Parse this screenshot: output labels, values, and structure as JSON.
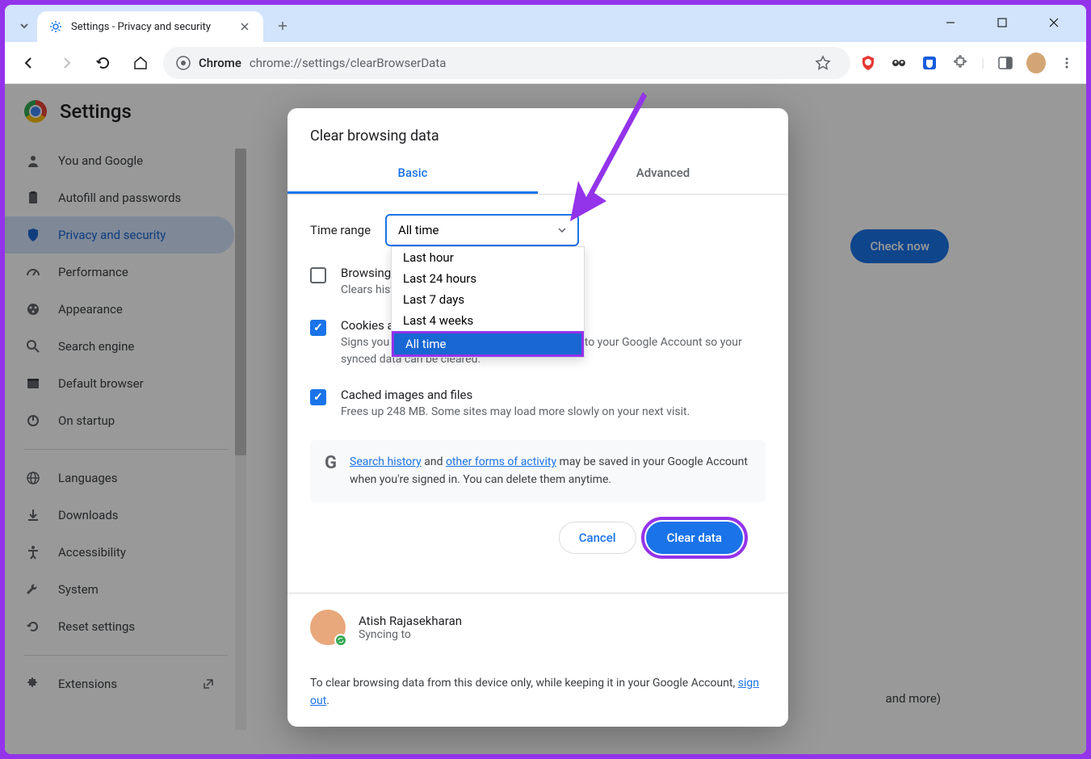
{
  "window": {
    "tab_title": "Settings - Privacy and security",
    "omnibox_label": "Chrome",
    "url": "chrome://settings/clearBrowserData"
  },
  "settings": {
    "title": "Settings",
    "nav": [
      {
        "label": "You and Google",
        "icon": "person"
      },
      {
        "label": "Autofill and passwords",
        "icon": "clipboard"
      },
      {
        "label": "Privacy and security",
        "icon": "shield"
      },
      {
        "label": "Performance",
        "icon": "speedometer"
      },
      {
        "label": "Appearance",
        "icon": "palette"
      },
      {
        "label": "Search engine",
        "icon": "search"
      },
      {
        "label": "Default browser",
        "icon": "browser"
      },
      {
        "label": "On startup",
        "icon": "power"
      }
    ],
    "nav2": [
      {
        "label": "Languages",
        "icon": "globe"
      },
      {
        "label": "Downloads",
        "icon": "download"
      },
      {
        "label": "Accessibility",
        "icon": "accessibility"
      },
      {
        "label": "System",
        "icon": "wrench"
      },
      {
        "label": "Reset settings",
        "icon": "reset"
      }
    ],
    "nav3": [
      {
        "label": "Extensions",
        "icon": "puzzle"
      }
    ],
    "check_now": "Check now",
    "bg_text": "and more)"
  },
  "dialog": {
    "title": "Clear browsing data",
    "tabs": {
      "basic": "Basic",
      "advanced": "Advanced"
    },
    "time_range_label": "Time range",
    "time_range_value": "All time",
    "time_range_options": [
      "Last hour",
      "Last 24 hours",
      "Last 7 days",
      "Last 4 weeks",
      "All time"
    ],
    "items": [
      {
        "checked": false,
        "title": "Browsing history",
        "desc": "Clears history"
      },
      {
        "checked": true,
        "title": "Cookies and other site data",
        "desc": "Signs you out of most sites. You'll stay signed in to your Google Account so your synced data can be cleared."
      },
      {
        "checked": true,
        "title": "Cached images and files",
        "desc": "Frees up 248 MB. Some sites may load more slowly on your next visit."
      }
    ],
    "info": {
      "link1": "Search history",
      "mid": " and ",
      "link2": "other forms of activity",
      "rest": " may be saved in your Google Account when you're signed in. You can delete them anytime."
    },
    "cancel": "Cancel",
    "clear": "Clear data",
    "account": {
      "name": "Atish Rajasekharan",
      "sync": "Syncing to"
    },
    "footer_text": "To clear browsing data from this device only, while keeping it in your Google Account, ",
    "footer_link": "sign out",
    "footer_period": "."
  }
}
